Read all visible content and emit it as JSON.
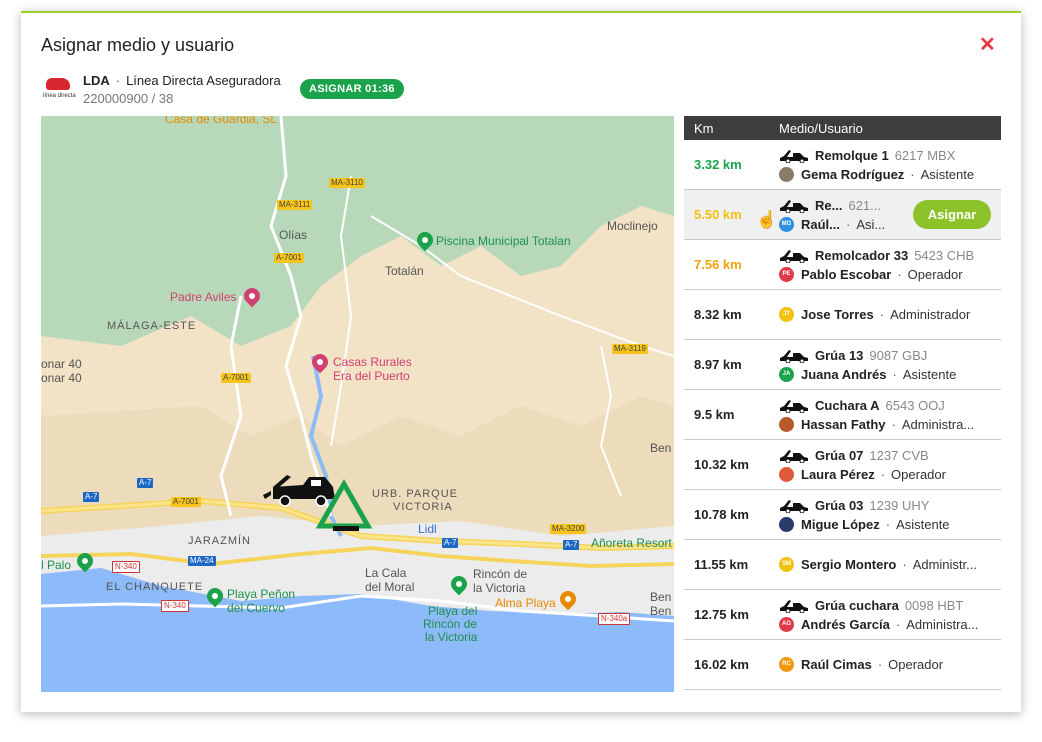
{
  "modal": {
    "title": "Asignar medio y usuario"
  },
  "client": {
    "logo_text": "línea directa",
    "code": "LDA",
    "name": "Línea Directa Aseguradora",
    "ref": "220000900 / 38",
    "badge": "ASIGNAR 01:36"
  },
  "map": {
    "labels": {
      "casa_guardia": "Casa de Guardia, SL",
      "olias": "Olías",
      "piscina": "Piscina Municipal Totalan",
      "totalan": "Totalán",
      "moclinejo": "Moclinejo",
      "padre_aviles": "Padre Aviles",
      "malaga_este": "MÁLAGA-ESTE",
      "casas_rurales_1": "Casas Rurales",
      "casas_rurales_2": "Era del Puerto",
      "onar_1": "onar 40",
      "onar_2": "onar 40",
      "ben": "Ben",
      "urb_1": "URB. PARQUE",
      "urb_2": "VICTORIA",
      "lidl": "Lidl",
      "jarazmin": "JARAZMÍN",
      "anoreta": "Añoreta Resort",
      "el_palo": "l Palo",
      "el_chanquete": "EL CHANQUETE",
      "playa_penon_1": "Playa Peñon",
      "playa_penon_2": "del Cuervo",
      "la_cala_1": "La Cala",
      "la_cala_2": "del Moral",
      "rincon_1": "Rincón de",
      "rincon_2": "la Victoria",
      "alma_playa": "Alma Playa",
      "playa_rincon_1": "Playa del",
      "playa_rincon_2": "Rincón de",
      "playa_rincon_3": "la Victoria",
      "ben_2": "Ben",
      "ben_3": "Ben"
    },
    "roads": {
      "ma3110": "MA-3110",
      "ma3111": "MA-3111",
      "a7001_a": "A-7001",
      "a7001_b": "A-7001",
      "a7001_c": "A-7001",
      "ma3119": "MA-3119",
      "a7_a": "A-7",
      "a7_b": "A-7",
      "a7_c": "A-7",
      "a7_d": "A-7",
      "ma24": "MA-24",
      "n340_a": "N-340",
      "n340_b": "N-340",
      "n340_c": "N-340a",
      "ma3200": "MA-3200"
    }
  },
  "table": {
    "headers": {
      "km": "Km",
      "medio": "Medio/Usuario"
    },
    "assign_label": "Asignar",
    "rows": [
      {
        "km": "3.32 km",
        "vehicle": "Remolque 1",
        "plate": "6217 MBX",
        "user": "Gema Rodríguez",
        "role": "Asistente"
      },
      {
        "km": "5.50 km",
        "vehicle": "Re...",
        "plate": "621...",
        "user": "Raúl...",
        "role": "Asi...",
        "initials": "MG"
      },
      {
        "km": "7.56 km",
        "vehicle": "Remolcador 33",
        "plate": "5423 CHB",
        "user": "Pablo Escobar",
        "role": "Operador",
        "initials": "PE"
      },
      {
        "km": "8.32 km",
        "user": "Jose Torres",
        "role": "Administrador",
        "initials": "JT"
      },
      {
        "km": "8.97 km",
        "vehicle": "Grúa 13",
        "plate": "9087 GBJ",
        "user": "Juana Andrés",
        "role": "Asistente",
        "initials": "JA"
      },
      {
        "km": "9.5 km",
        "vehicle": "Cuchara A",
        "plate": "6543 OOJ",
        "user": "Hassan Fathy",
        "role": "Administra..."
      },
      {
        "km": "10.32 km",
        "vehicle": "Grúa 07",
        "plate": "1237 CVB",
        "user": "Laura Pérez",
        "role": "Operador"
      },
      {
        "km": "10.78 km",
        "vehicle": "Grúa 03",
        "plate": "1239 UHY",
        "user": "Migue López",
        "role": "Asistente"
      },
      {
        "km": "11.55 km",
        "user": "Sergio Montero",
        "role": "Administr...",
        "initials": "SM"
      },
      {
        "km": "12.75 km",
        "vehicle": "Grúa cuchara",
        "plate": "0098 HBT",
        "user": "Andrés García",
        "role": "Administra...",
        "initials": "AG"
      },
      {
        "km": "16.02 km",
        "user": "Raúl Cimas",
        "role": "Operador",
        "initials": "RC"
      }
    ]
  },
  "colors": {
    "accent_green": "#1aa34a",
    "assign_green": "#8cc22a",
    "km_orange": "#f2a20f",
    "km_yellow": "#f2c10f",
    "close_red": "#e83845",
    "header_dark": "#3d3d3d"
  }
}
